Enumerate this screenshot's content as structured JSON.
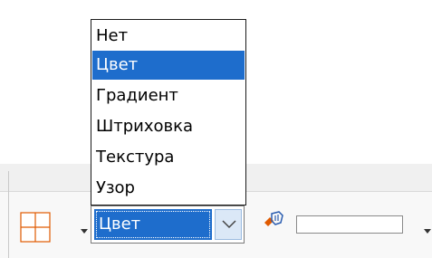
{
  "dropdown": {
    "items": [
      {
        "label": "Нет"
      },
      {
        "label": "Цвет"
      },
      {
        "label": "Градиент"
      },
      {
        "label": "Штриховка"
      },
      {
        "label": "Текстура"
      },
      {
        "label": "Узор"
      }
    ],
    "selected_index": 1
  },
  "toolbar": {
    "area_style_value": "Цвет",
    "borders_icon": "borders-icon",
    "highlight_icon": "highlight-color-icon"
  },
  "colors": {
    "selection": "#1e6dcc",
    "selection_text": "#ffffff",
    "border": "#1a1a1a"
  }
}
